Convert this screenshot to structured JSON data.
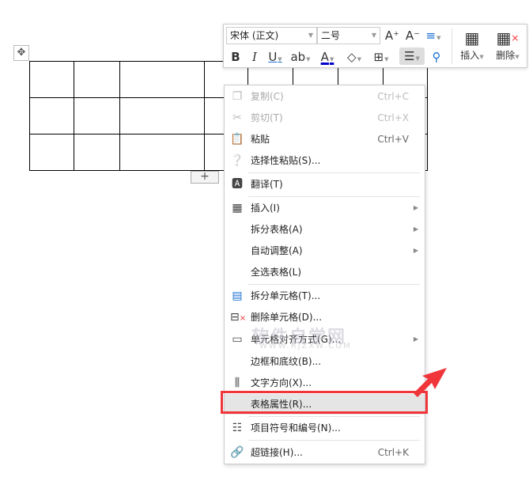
{
  "toolbar": {
    "font_name": "宋体 (正文)",
    "font_size": "二号",
    "grow_font": "A⁺",
    "shrink_font": "A⁻",
    "insert_label": "插入",
    "delete_label": "删除"
  },
  "table": {
    "plus_label": "+"
  },
  "menu": {
    "items": [
      {
        "label": "复制(C)",
        "shortcut": "Ctrl+C",
        "icon": "copy-icon",
        "disabled": true
      },
      {
        "label": "剪切(T)",
        "shortcut": "Ctrl+X",
        "icon": "scissors-icon",
        "disabled": true
      },
      {
        "label": "粘贴",
        "shortcut": "Ctrl+V",
        "icon": "paste-icon"
      },
      {
        "label": "选择性粘贴(S)...",
        "icon": "paste-special-icon"
      },
      {
        "label": "翻译(T)",
        "icon": "translate-icon"
      },
      {
        "label": "插入(I)",
        "icon": "table-insert-icon",
        "submenu": true
      },
      {
        "label": "拆分表格(A)",
        "submenu": true
      },
      {
        "label": "自动调整(A)",
        "submenu": true
      },
      {
        "label": "全选表格(L)"
      },
      {
        "label": "拆分单元格(T)...",
        "icon": "split-cells-icon"
      },
      {
        "label": "删除单元格(D)...",
        "icon": "delete-cells-icon"
      },
      {
        "label": "单元格对齐方式(G)...",
        "icon": "align-icon",
        "submenu": true
      },
      {
        "label": "边框和底纹(B)..."
      },
      {
        "label": "文字方向(X)...",
        "icon": "text-direction-icon"
      },
      {
        "label": "表格属性(R)...",
        "highlighted": true
      },
      {
        "label": "项目符号和编号(N)...",
        "icon": "list-icon"
      },
      {
        "label": "超链接(H)...",
        "shortcut": "Ctrl+K",
        "icon": "link-icon"
      }
    ]
  },
  "watermark": {
    "title": "软件自学网",
    "url": "WWW.RJZXW.COM"
  },
  "colors": {
    "highlight": "#f0353b",
    "accent": "#1a6fd0"
  }
}
